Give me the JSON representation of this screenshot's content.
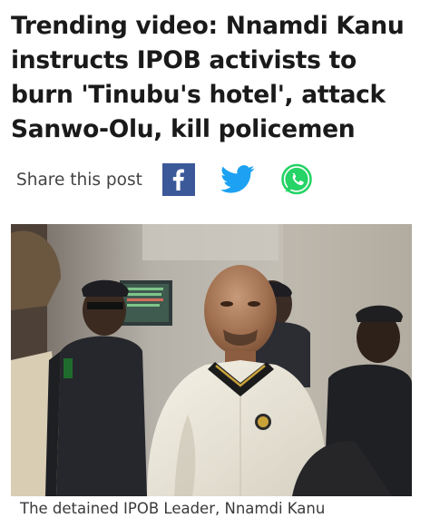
{
  "article": {
    "headline": "Trending video: Nnamdi Kanu instructs IPOB activists to burn 'Tinubu's hotel', attack Sanwo-Olu, kill policemen",
    "share": {
      "label": "Share this post",
      "buttons": [
        {
          "name": "facebook",
          "icon": "facebook-icon",
          "color": "#3b5998"
        },
        {
          "name": "twitter",
          "icon": "twitter-icon",
          "color": "#1da1f2"
        },
        {
          "name": "whatsapp",
          "icon": "whatsapp-icon",
          "color": "#25d366"
        }
      ]
    },
    "photo": {
      "caption": "The detained IPOB Leader, Nnamdi Kanu"
    }
  }
}
